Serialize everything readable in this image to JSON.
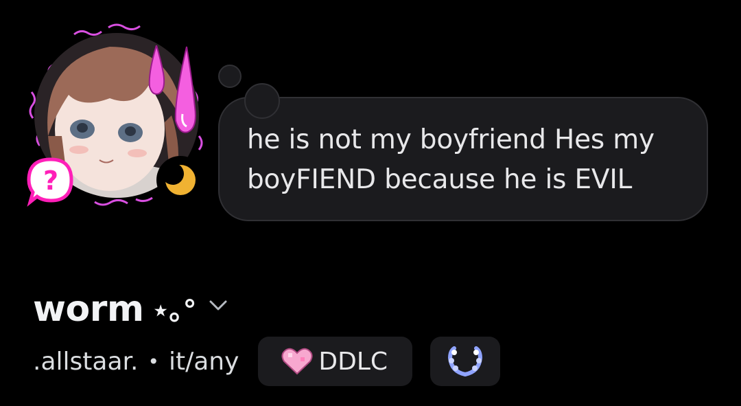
{
  "profile": {
    "display_name": "worm",
    "name_decoration": "⋆｡°",
    "username": ".allstaar.",
    "separator": "•",
    "pronouns": "it/any",
    "status_indicator": "idle-moon-icon",
    "avatar_badge": "question-mark-badge-icon"
  },
  "custom_status": {
    "text": "he is not my boyfriend Hes my boyFIEND because he is EVIL"
  },
  "tags": [
    {
      "label": "DDLC",
      "icon": "pink-heart-icon"
    }
  ],
  "badges": [
    {
      "icon": "laurel-wreath-badge-icon"
    }
  ],
  "colors": {
    "background": "#000000",
    "bubble": "#1b1b1e",
    "bubble_border": "#303034",
    "accent_pink": "#ff4fd8",
    "idle_moon": "#f0b232",
    "badge_blue": "#8fa3ff"
  }
}
